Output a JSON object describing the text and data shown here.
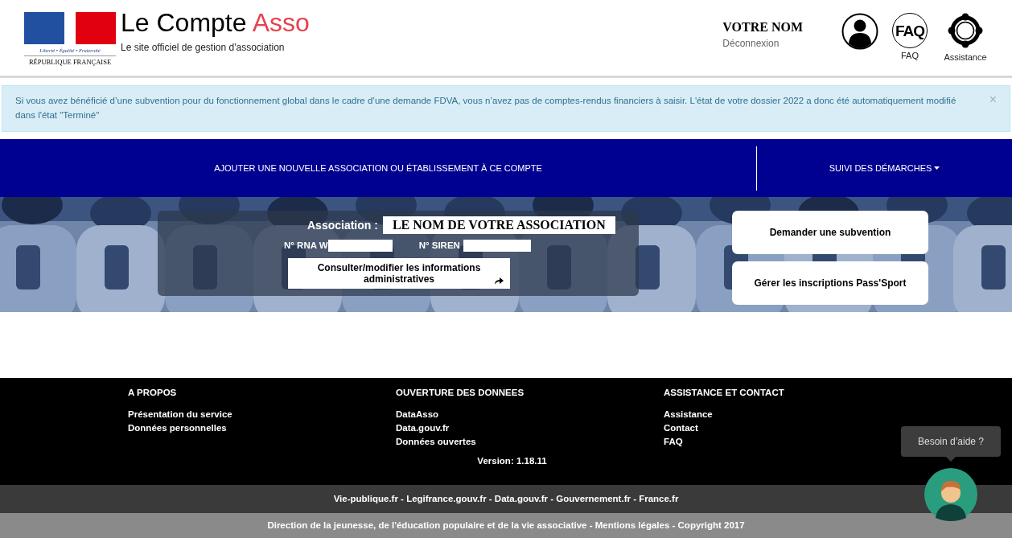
{
  "header": {
    "logo": {
      "motto": "Liberté • Égalité • Fraternité",
      "country": "RÉPUBLIQUE FRANÇAISE"
    },
    "title": "Le Compte",
    "title_accent": "Asso",
    "subtitle": "Le site officiel de gestion d'association",
    "user": {
      "name": "VOTRE NOM",
      "logout": "Déconnexion"
    },
    "icons": [
      {
        "kind": "user"
      },
      {
        "kind": "faq",
        "glyph": "FAQ",
        "label": "FAQ"
      },
      {
        "kind": "lifebuoy",
        "label": "Assistance"
      }
    ]
  },
  "alert": {
    "text": "Si vous avez bénéficié d’une subvention pour du fonctionnement global dans le cadre d’une demande FDVA, vous n’avez pas de comptes-rendus financiers à saisir. L'état de votre dossier 2022 a donc été automatiquement modifié dans l'état \"Terminé\"",
    "close": "×"
  },
  "nav": [
    {
      "label": "AJOUTER UNE NOUVELLE ASSOCIATION OU ÉTABLISSEMENT À CE COMPTE",
      "dropdown": false
    },
    {
      "label": "SUIVI DES DÉMARCHES",
      "dropdown": true
    }
  ],
  "banner": {
    "association_label": "Association :",
    "association_name": "LE NOM DE VOTRE ASSOCIATION",
    "rna_label": "N° RNA W",
    "siren_label": "N° SIREN",
    "info_button": "Consulter/modifier les informations administratives",
    "actions": [
      "Demander une subvention",
      "Gérer les inscriptions Pass'Sport"
    ]
  },
  "footer": {
    "columns": [
      {
        "title": "A PROPOS",
        "links": [
          "Présentation du service",
          "Données personnelles"
        ]
      },
      {
        "title": "OUVERTURE DES DONNEES",
        "links": [
          "DataAsso",
          "Data.gouv.fr",
          "Données ouvertes"
        ]
      },
      {
        "title": "ASSISTANCE ET CONTACT",
        "links": [
          "Assistance",
          "Contact",
          "FAQ"
        ]
      }
    ],
    "version": "Version: 1.18.11",
    "gov_links": "Vie-publique.fr - Legifrance.gouv.fr - Data.gouv.fr - Gouvernement.fr - France.fr",
    "credits": "Direction de la jeunesse, de l'éducation populaire et de la vie associative - Mentions légales - Copyright 2017"
  },
  "help": {
    "tooltip": "Besoin d’aide ?"
  }
}
